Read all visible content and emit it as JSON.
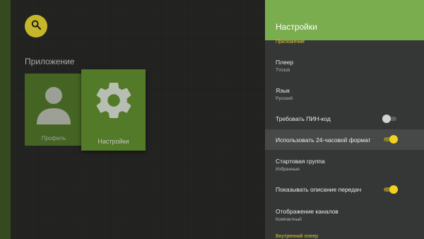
{
  "colors": {
    "accent": "#7aad4e",
    "toggle_on": "#f2d21c",
    "group_label": "#e0c52a",
    "tile": "#527a29"
  },
  "search": {
    "icon": "search-icon"
  },
  "launcher": {
    "section_title": "Приложение",
    "tiles": [
      {
        "label": "Профиль",
        "icon": "person-icon"
      },
      {
        "label": "Настройки",
        "icon": "gear-icon"
      }
    ]
  },
  "settings": {
    "title": "Настройки",
    "group_app": "Приложение",
    "items": [
      {
        "title": "Плеер",
        "value": "TVclub"
      },
      {
        "title": "Язык",
        "value": "Русский"
      },
      {
        "title": "Требовать ПИН-код",
        "toggle": false
      },
      {
        "title": "Использовать 24-часовой формат",
        "toggle": true
      },
      {
        "title": "Стартовая группа",
        "value": "Избранные"
      },
      {
        "title": "Показывать описание передач",
        "toggle": true
      },
      {
        "title": "Отображение каналов",
        "value": "Компактный"
      }
    ],
    "group_next": "Внутренний плеер"
  }
}
